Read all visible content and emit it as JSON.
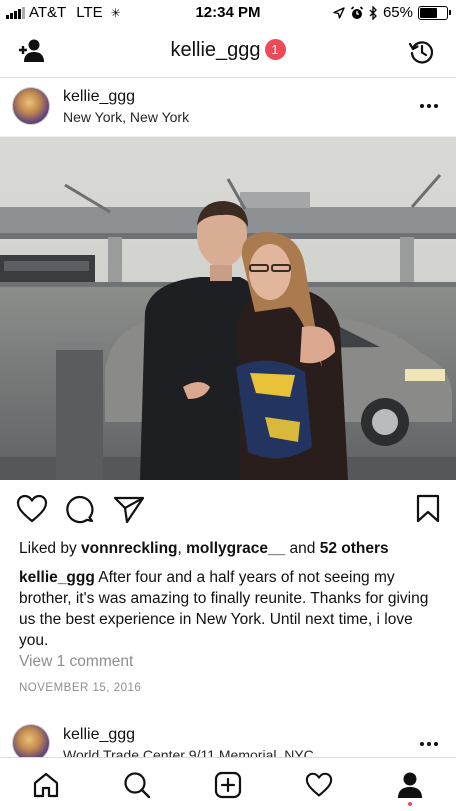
{
  "status_bar": {
    "carrier": "AT&T",
    "network": "LTE",
    "time": "12:34 PM",
    "battery": "65%",
    "battery_level": 0.65
  },
  "header": {
    "title": "kellie_ggg",
    "notification_count": "1"
  },
  "post": {
    "username": "kellie_ggg",
    "location": "New York, New York",
    "likes_prefix": "Liked by ",
    "liker_1": "vonnreckling",
    "liker_sep": ", ",
    "liker_2": "mollygrace__",
    "likes_and": " and ",
    "likes_others": "52 others",
    "caption_user": "kellie_ggg",
    "caption_text": " After four and a half years of not seeing my brother, it's was amazing to finally reunite. Thanks for giving us the best experience in New York. Until next time, i love you.",
    "view_comments": "View 1 comment",
    "date": "NOVEMBER 15, 2016"
  },
  "next_post": {
    "username": "kellie_ggg",
    "location": "World Trade Center 9/11 Memorial, NYC"
  },
  "icons": {
    "add_person": "add-person-icon",
    "history": "history-icon",
    "more": "more-icon",
    "like": "heart-icon",
    "comment": "comment-icon",
    "share": "paper-plane-icon",
    "save": "bookmark-icon",
    "home": "home-icon",
    "search": "search-icon",
    "new_post": "plus-square-icon",
    "activity": "heart-icon",
    "profile": "profile-icon"
  },
  "colors": {
    "accent_red": "#ed4956",
    "secondary_text": "#8e8e8e",
    "divider": "#dbdbdb"
  }
}
